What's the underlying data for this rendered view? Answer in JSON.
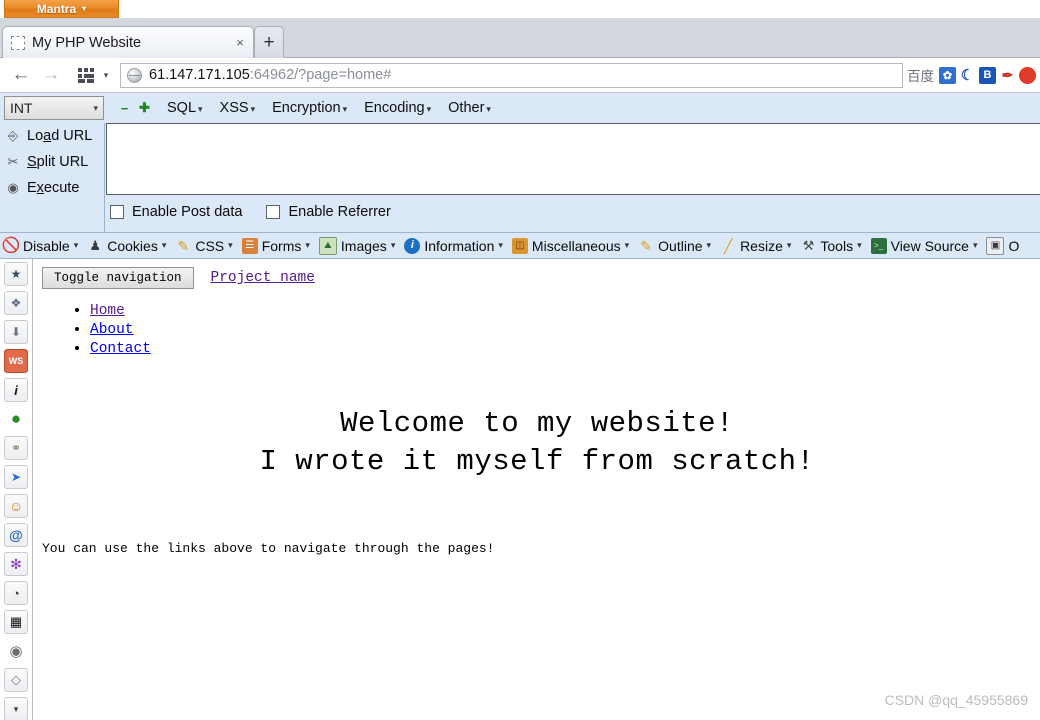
{
  "mantra": {
    "label": "Mantra",
    "caret": "▾"
  },
  "tabs": {
    "active": {
      "title": "My PHP Website",
      "close": "×",
      "favicon_icon": "blank-favicon"
    },
    "new_tab_label": "+"
  },
  "nav": {
    "back_icon": "←",
    "forward_icon": "→",
    "grid_icon": "grid-icon",
    "grid_caret": "▾",
    "url_host": "61.147.171.105",
    "url_rest": ":64962/?page=home#",
    "url_full": "61.147.171.105:64962/?page=home#",
    "search_label": "百度",
    "engines": [
      {
        "name": "baidu-paw-icon",
        "glyph": "✿",
        "color": "#2f6fd0"
      },
      {
        "name": "moon-search-icon",
        "glyph": "☾",
        "color": "#2c5fae"
      },
      {
        "name": "bing-icon",
        "glyph": "B",
        "color": "#1a55b8"
      },
      {
        "name": "pen-search-icon",
        "glyph": "✒",
        "color": "#c0392b"
      },
      {
        "name": "red-circle-icon",
        "glyph": "◉",
        "color": "#e03a28"
      }
    ]
  },
  "hackbar": {
    "type_select": {
      "value": "INT",
      "caret": "▾"
    },
    "minus_icon": "−",
    "plus_icon": "✚",
    "menus": [
      {
        "label": "SQL",
        "caret": "▾"
      },
      {
        "label": "XSS",
        "caret": "▾"
      },
      {
        "label": "Encryption",
        "caret": "▾"
      },
      {
        "label": "Encoding",
        "caret": "▾"
      },
      {
        "label": "Other",
        "caret": "▾"
      }
    ],
    "actions": [
      {
        "name": "load-url",
        "pre": "Lo",
        "accel": "a",
        "post": "d URL",
        "icon": "⌨"
      },
      {
        "name": "split-url",
        "pre": "",
        "accel": "S",
        "post": "plit URL",
        "icon": "✂"
      },
      {
        "name": "execute",
        "pre": "E",
        "accel": "x",
        "post": "ecute",
        "icon": "▶"
      }
    ],
    "textarea_value": "",
    "checkboxes": [
      {
        "name": "enable-post-data",
        "label": "Enable Post data",
        "checked": false
      },
      {
        "name": "enable-referrer",
        "label": "Enable Referrer",
        "checked": false
      }
    ]
  },
  "webdev_toolbar": {
    "items": [
      {
        "label": "Disable",
        "icon": "disable-icon",
        "glyph": "⃠",
        "color": "#d11a1a",
        "caret": "▾"
      },
      {
        "label": "Cookies",
        "icon": "cookie-icon",
        "glyph": "♟",
        "color": "#3a3a3a",
        "caret": "▾"
      },
      {
        "label": "CSS",
        "icon": "pencil-icon",
        "glyph": "✎",
        "color": "#d8a21a",
        "caret": "▾"
      },
      {
        "label": "Forms",
        "icon": "clipboard-icon",
        "glyph": "▤",
        "color": "#c0632a",
        "caret": "▾"
      },
      {
        "label": "Images",
        "icon": "image-icon",
        "glyph": "⛰",
        "color": "#3f7d3f",
        "caret": "▾"
      },
      {
        "label": "Information",
        "icon": "info-icon",
        "glyph": "i",
        "color": "#1a6fc4",
        "caret": "▾"
      },
      {
        "label": "Miscellaneous",
        "icon": "book-icon",
        "glyph": "☷",
        "color": "#c07a2a",
        "caret": "▾"
      },
      {
        "label": "Outline",
        "icon": "pencil-icon",
        "glyph": "✎",
        "color": "#d8a21a",
        "caret": "▾"
      },
      {
        "label": "Resize",
        "icon": "ruler-icon",
        "glyph": "╱",
        "color": "#d8a21a",
        "caret": "▾"
      },
      {
        "label": "Tools",
        "icon": "tools-icon",
        "glyph": "⚒",
        "color": "#4a4a4a",
        "caret": "▾"
      },
      {
        "label": "View Source",
        "icon": "terminal-icon",
        "glyph": "■",
        "color": "#2f6f2f",
        "caret": "▾"
      },
      {
        "label": "O",
        "icon": "options-icon",
        "glyph": "◫",
        "color": "#3a3a3a",
        "caret": ""
      }
    ]
  },
  "sidebar": {
    "items": [
      {
        "name": "bookmark-star-icon",
        "glyph": "★",
        "color": "#3a4a66"
      },
      {
        "name": "puzzle-piece-icon",
        "glyph": "❖",
        "color": "#5a6a80"
      },
      {
        "name": "download-arrow-icon",
        "glyph": "⬇",
        "color": "#6a7380"
      },
      {
        "name": "web-security-icon",
        "glyph": "WS",
        "color": "#ffffff",
        "bg": "#e06a4a"
      },
      {
        "name": "information-italic-icon",
        "glyph": "i",
        "color": "#1a1a1a"
      },
      {
        "name": "green-circle-icon",
        "glyph": "●",
        "color": "#2e8b2e"
      },
      {
        "name": "chain-link-icon",
        "glyph": "⚭",
        "color": "#8a7a5a"
      },
      {
        "name": "cursor-select-icon",
        "glyph": "➤",
        "color": "#2a6fd0"
      },
      {
        "name": "orange-avatar-icon",
        "glyph": "☺",
        "color": "#d07a1a"
      },
      {
        "name": "blue-spiral-icon",
        "glyph": "ə",
        "color": "#2a5fc0"
      },
      {
        "name": "purple-bug-icon",
        "glyph": "✻",
        "color": "#8a3fc0"
      },
      {
        "name": "palette-icon",
        "glyph": "◔",
        "color": "#3a3a3a"
      },
      {
        "name": "grid-table-icon",
        "glyph": "▦",
        "color": "#1a1a1a"
      },
      {
        "name": "globe-grey-icon",
        "glyph": "⊕",
        "color": "#6a6a6a"
      },
      {
        "name": "page-paper-icon",
        "glyph": "◧",
        "color": "#7a8490"
      },
      {
        "name": "more-chevron-icon",
        "glyph": "▾",
        "color": "#3a3a3a"
      }
    ]
  },
  "page": {
    "toggle_nav_label": "Toggle navigation",
    "brand_label": "Project name",
    "nav_links": [
      {
        "label": "Home",
        "state": "visited"
      },
      {
        "label": "About",
        "state": "unvisited"
      },
      {
        "label": "Contact",
        "state": "unvisited"
      }
    ],
    "heading_line1": "Welcome to my website!",
    "heading_line2": "I wrote it myself from scratch!",
    "tagline": "You can use the links above to navigate through the pages!"
  },
  "watermark": {
    "text": "CSDN @qq_45955869"
  }
}
